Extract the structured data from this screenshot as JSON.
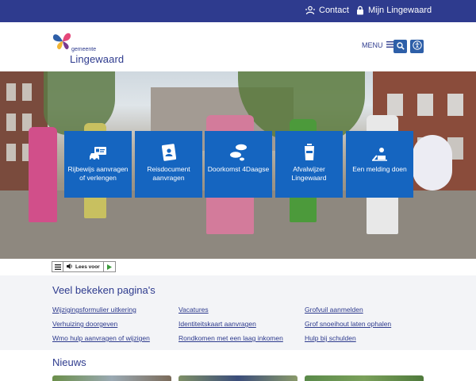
{
  "topbar": {
    "contact_label": "Contact",
    "mijn_label": "Mijn Lingewaard"
  },
  "header": {
    "logo_small": "gemeente",
    "logo_name": "Lingewaard",
    "menu_label": "MENU"
  },
  "tiles": [
    {
      "label": "Rijbewijs aanvragen of verlengen",
      "icon": "car-license-icon"
    },
    {
      "label": "Reisdocument aanvragen",
      "icon": "passport-icon"
    },
    {
      "label": "Doorkomst 4Daagse",
      "icon": "footsteps-icon"
    },
    {
      "label": "Afvalwijzer Lingewaard",
      "icon": "waste-bin-icon"
    },
    {
      "label": "Een melding doen",
      "icon": "report-worker-icon"
    }
  ],
  "readbar": {
    "lees_label": "Lees voor"
  },
  "popular": {
    "title": "Veel bekeken pagina's",
    "links": [
      [
        "Wijzigingsformulier uitkering",
        "Vacatures",
        "Grofvuil aanmelden"
      ],
      [
        "Verhuizing doorgeven",
        "Identiteitskaart aanvragen",
        "Grof snoeihout laten ophalen"
      ],
      [
        "Wmo hulp aanvragen of wijzigen",
        "Rondkomen met een laag inkomen",
        "Hulp bij schulden"
      ]
    ]
  },
  "news": {
    "title": "Nieuws"
  },
  "colors": {
    "topbar": "#2e3b8e",
    "tile": "#1565c0",
    "link": "#2e3b8e",
    "popular_bg": "#f3f4f7"
  }
}
